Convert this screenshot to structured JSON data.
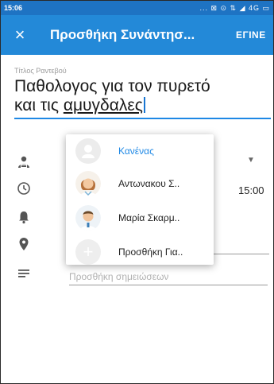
{
  "status_bar": {
    "time": "15:06",
    "indicators": "... ⊠ ⊙ ⇅ ◢ 4G ▭"
  },
  "app_bar": {
    "close_icon": "close-icon",
    "title": "Προσθήκη Συνάντησ...",
    "done_label": "ΕΓΙΝΕ"
  },
  "form": {
    "title_label": "Τίτλος Ραντεβού",
    "title_text_line1": "Παθολογος για τον πυρετό",
    "title_text_line2_prefix": "και τις ",
    "title_text_line2_underlined": "αμυγδαλες",
    "time_value": "15:00",
    "notes_placeholder": "Προσθήκη σημειώσεων"
  },
  "attendee_popup": {
    "options": [
      {
        "label": "Κανένας",
        "icon": "person-placeholder-icon",
        "selected": true
      },
      {
        "label": "Αντωνακου Σ..",
        "icon": "female-doctor-avatar"
      },
      {
        "label": "Μαρία Σκαρμ..",
        "icon": "male-doctor-avatar"
      },
      {
        "label": "Προσθήκη Για..",
        "icon": "add-icon"
      }
    ]
  },
  "colors": {
    "status_bar": "#1e73c3",
    "app_bar": "#2389d8",
    "accent": "#1e88e5",
    "selected_option": "#1e88e5"
  }
}
